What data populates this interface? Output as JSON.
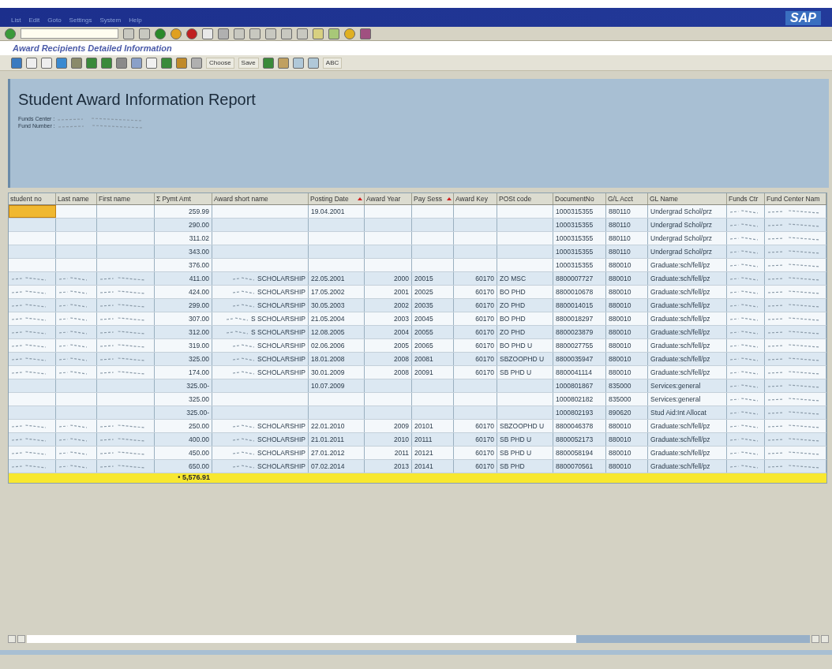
{
  "menu": [
    "List",
    "Edit",
    "Goto",
    "Settings",
    "System",
    "Help"
  ],
  "brand": "SAP",
  "screen_title": "Award Recipients Detailed Information",
  "app_toolbar": [
    {
      "kind": "icon"
    },
    {
      "kind": "icon"
    },
    {
      "kind": "icon"
    },
    {
      "kind": "icon"
    },
    {
      "kind": "icon"
    },
    {
      "kind": "icon"
    },
    {
      "kind": "icon"
    },
    {
      "kind": "icon"
    },
    {
      "kind": "icon"
    },
    {
      "kind": "icon"
    },
    {
      "kind": "icon"
    },
    {
      "kind": "icon"
    },
    {
      "kind": "icon"
    },
    {
      "kind": "text",
      "label": "Choose"
    },
    {
      "kind": "text",
      "label": "Save"
    },
    {
      "kind": "icon"
    },
    {
      "kind": "icon"
    },
    {
      "kind": "icon"
    },
    {
      "kind": "icon"
    },
    {
      "kind": "text",
      "label": "ABC"
    }
  ],
  "report": {
    "title": "Student Award Information Report",
    "lines": [
      "Funds Center :",
      "Fund Number :"
    ]
  },
  "table": {
    "columns": [
      {
        "label": "student no",
        "kind": "masked",
        "sorted": false
      },
      {
        "label": "Last name",
        "kind": "masked",
        "sorted": false
      },
      {
        "label": "First name",
        "kind": "masked",
        "sorted": false
      },
      {
        "label": "Σ  Pymt Amt",
        "kind": "data",
        "sorted": false
      },
      {
        "label": "Award short name",
        "kind": "data",
        "sorted": false
      },
      {
        "label": "Posting Date",
        "kind": "data",
        "sorted": true
      },
      {
        "label": "Award Year",
        "kind": "data",
        "sorted": false
      },
      {
        "label": "Pay Sess",
        "kind": "data",
        "sorted": true
      },
      {
        "label": "Award Key",
        "kind": "data",
        "sorted": false
      },
      {
        "label": "POSt code",
        "kind": "data",
        "sorted": false
      },
      {
        "label": "DocumentNo",
        "kind": "data",
        "sorted": false
      },
      {
        "label": "G/L Acct",
        "kind": "data",
        "sorted": false
      },
      {
        "label": "GL Name",
        "kind": "data",
        "sorted": false
      },
      {
        "label": "Funds Ctr",
        "kind": "fund",
        "sorted": false
      },
      {
        "label": "Fund Center Nam",
        "kind": "fund",
        "sorted": false
      }
    ],
    "rows": [
      {
        "selected": true,
        "masked": false,
        "amount": "259.99",
        "posting_date": "19.04.2001",
        "document_no": "1000315355",
        "gl_acct": "880110",
        "gl_name": "Undergrad Schol/prz"
      },
      {
        "selected": false,
        "masked": false,
        "amount": "290.00",
        "document_no": "1000315355",
        "gl_acct": "880110",
        "gl_name": "Undergrad Schol/prz"
      },
      {
        "selected": false,
        "masked": false,
        "amount": "311.02",
        "document_no": "1000315355",
        "gl_acct": "880110",
        "gl_name": "Undergrad Schol/prz"
      },
      {
        "selected": false,
        "masked": false,
        "amount": "343.00",
        "document_no": "1000315355",
        "gl_acct": "880110",
        "gl_name": "Undergrad Schol/prz"
      },
      {
        "selected": false,
        "masked": false,
        "amount": "376.00",
        "document_no": "1000315355",
        "gl_acct": "880010",
        "gl_name": "Graduate:sch/fell/pz"
      },
      {
        "selected": false,
        "masked": true,
        "amount": "411.00",
        "award_short_name": "SCHOLARSHIP",
        "posting_date": "22.05.2001",
        "award_year": "2000",
        "pay_session": "20015",
        "award_key": "60170",
        "post_code": "ZO   MSC",
        "document_no": "8800007727",
        "gl_acct": "880010",
        "gl_name": "Graduate:sch/fell/pz"
      },
      {
        "selected": false,
        "masked": true,
        "amount": "424.00",
        "award_short_name": "SCHOLARSHIP",
        "posting_date": "17.05.2002",
        "award_year": "2001",
        "pay_session": "20025",
        "award_key": "60170",
        "post_code": "BO   PHD",
        "document_no": "8800010678",
        "gl_acct": "880010",
        "gl_name": "Graduate:sch/fell/pz"
      },
      {
        "selected": false,
        "masked": true,
        "amount": "299.00",
        "award_short_name": "SCHOLARSHIP",
        "posting_date": "30.05.2003",
        "award_year": "2002",
        "pay_session": "20035",
        "award_key": "60170",
        "post_code": "ZO   PHD",
        "document_no": "8800014015",
        "gl_acct": "880010",
        "gl_name": "Graduate:sch/fell/pz"
      },
      {
        "selected": false,
        "masked": true,
        "amount": "307.00",
        "award_short_name": "S SCHOLARSHIP",
        "posting_date": "21.05.2004",
        "award_year": "2003",
        "pay_session": "20045",
        "award_key": "60170",
        "post_code": "BO   PHD",
        "document_no": "8800018297",
        "gl_acct": "880010",
        "gl_name": "Graduate:sch/fell/pz"
      },
      {
        "selected": false,
        "masked": true,
        "amount": "312.00",
        "award_short_name": "S SCHOLARSHIP",
        "posting_date": "12.08.2005",
        "award_year": "2004",
        "pay_session": "20055",
        "award_key": "60170",
        "post_code": "ZO   PHD",
        "document_no": "8800023879",
        "gl_acct": "880010",
        "gl_name": "Graduate:sch/fell/pz"
      },
      {
        "selected": false,
        "masked": true,
        "amount": "319.00",
        "award_short_name": "SCHOLARSHIP",
        "posting_date": "02.06.2006",
        "award_year": "2005",
        "pay_session": "20065",
        "award_key": "60170",
        "post_code": "BO   PHD U",
        "document_no": "8800027755",
        "gl_acct": "880010",
        "gl_name": "Graduate:sch/fell/pz"
      },
      {
        "selected": false,
        "masked": true,
        "amount": "325.00",
        "award_short_name": "SCHOLARSHIP",
        "posting_date": "18.01.2008",
        "award_year": "2008",
        "pay_session": "20081",
        "award_key": "60170",
        "post_code": "SBZOOPHD U",
        "document_no": "8800035947",
        "gl_acct": "880010",
        "gl_name": "Graduate:sch/fell/pz"
      },
      {
        "selected": false,
        "masked": true,
        "amount": "174.00",
        "award_short_name": "SCHOLARSHIP",
        "posting_date": "30.01.2009",
        "award_year": "2008",
        "pay_session": "20091",
        "award_key": "60170",
        "post_code": "SB   PHD U",
        "document_no": "8800041114",
        "gl_acct": "880010",
        "gl_name": "Graduate:sch/fell/pz"
      },
      {
        "selected": false,
        "masked": false,
        "amount": "325.00-",
        "posting_date": "10.07.2009",
        "document_no": "1000801867",
        "gl_acct": "835000",
        "gl_name": "Services:general"
      },
      {
        "selected": false,
        "masked": false,
        "amount": "325.00",
        "document_no": "1000802182",
        "gl_acct": "835000",
        "gl_name": "Services:general"
      },
      {
        "selected": false,
        "masked": false,
        "amount": "325.00-",
        "document_no": "1000802193",
        "gl_acct": "890620",
        "gl_name": "Stud Aid:Int Allocat"
      },
      {
        "selected": false,
        "masked": true,
        "amount": "250.00",
        "award_short_name": "SCHOLARSHIP",
        "posting_date": "22.01.2010",
        "award_year": "2009",
        "pay_session": "20101",
        "award_key": "60170",
        "post_code": "SBZOOPHD U",
        "document_no": "8800046378",
        "gl_acct": "880010",
        "gl_name": "Graduate:sch/fell/pz"
      },
      {
        "selected": false,
        "masked": true,
        "amount": "400.00",
        "award_short_name": "SCHOLARSHIP",
        "posting_date": "21.01.2011",
        "award_year": "2010",
        "pay_session": "20111",
        "award_key": "60170",
        "post_code": "SB   PHD U",
        "document_no": "8800052173",
        "gl_acct": "880010",
        "gl_name": "Graduate:sch/fell/pz"
      },
      {
        "selected": false,
        "masked": true,
        "amount": "450.00",
        "award_short_name": "SCHOLARSHIP",
        "posting_date": "27.01.2012",
        "award_year": "2011",
        "pay_session": "20121",
        "award_key": "60170",
        "post_code": "SB   PHD U",
        "document_no": "8800058194",
        "gl_acct": "880010",
        "gl_name": "Graduate:sch/fell/pz"
      },
      {
        "selected": false,
        "masked": true,
        "amount": "650.00",
        "award_short_name": "SCHOLARSHIP",
        "posting_date": "07.02.2014",
        "award_year": "2013",
        "pay_session": "20141",
        "award_key": "60170",
        "post_code": "SB   PHD",
        "document_no": "8800070561",
        "gl_acct": "880010",
        "gl_name": "Graduate:sch/fell/pz"
      }
    ],
    "total": "• 5,576.91"
  }
}
